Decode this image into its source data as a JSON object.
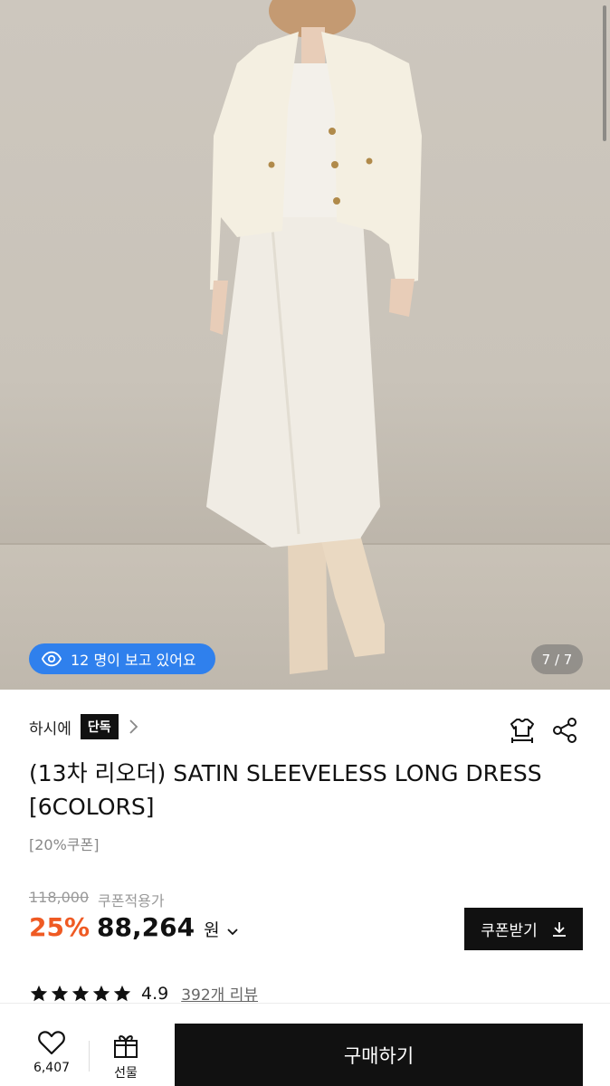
{
  "hero": {
    "viewer_text": "12 명이 보고 있어요",
    "page_counter": "7 / 7",
    "viewer_color": "#2f80ed"
  },
  "brand": {
    "name": "하시에",
    "exclusive_badge": "단독"
  },
  "product": {
    "title": "(13차 리오더) SATIN SLEEVELESS LONG DRESS [6COLORS]",
    "coupon_tag": "[20%쿠폰]",
    "original_price": "118,000",
    "price_note": "쿠폰적용가",
    "discount": "25%",
    "price": "88,264",
    "currency": "원",
    "discount_color": "#ef5a23"
  },
  "coupon_button": {
    "label": "쿠폰받기"
  },
  "rating": {
    "score": "4.9",
    "stars": 5,
    "reviews": "392개 리뷰"
  },
  "bottom_bar": {
    "like_count": "6,407",
    "gift_label": "선물",
    "buy_label": "구매하기"
  },
  "icons": [
    "eye-icon",
    "chevron-right-icon",
    "size-guide-icon",
    "share-icon",
    "download-icon",
    "star-icon",
    "heart-icon",
    "gift-icon",
    "chevron-down-icon"
  ]
}
